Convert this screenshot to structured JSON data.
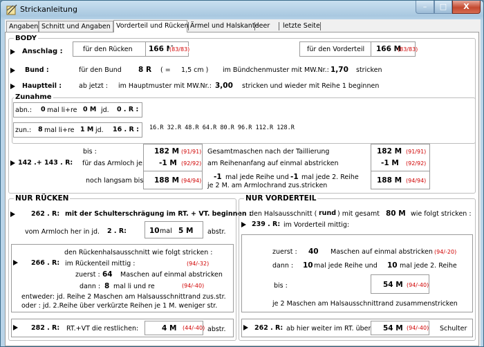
{
  "window": {
    "title": "Strickanleitung",
    "min": "–",
    "max": "□",
    "close": "X"
  },
  "tabs": [
    "Angaben",
    "Schnitt und Angaben",
    "Vorderteil und Rücken",
    "Ärmel und Halskante",
    "leer",
    "letzte Seite"
  ],
  "body": {
    "title": "BODY",
    "anschlag": {
      "label": "Anschlag :",
      "ruecken_label": "für den Rücken",
      "ruecken_val": "166 M",
      "ruecken_red": "(83/83)",
      "vorder_label": "für den Vorderteil",
      "vorder_val": "166 M",
      "vorder_red": "(83/83)"
    },
    "bund": {
      "label": "Bund :",
      "text1": "für den Bund",
      "r": "8  R",
      "eq": "(  =",
      "cm": "1,5  cm )",
      "text2": "im Bündchenmuster mit MW.Nr.:",
      "mw": "1,70",
      "text3": "stricken"
    },
    "hauptteil": {
      "label": "Hauptteil :",
      "text1": "ab jetzt :",
      "text2": "im Hauptmuster mit MW.Nr.:",
      "mw": "3,00",
      "text3": "stricken  und wieder mit Reihe 1 beginnen"
    },
    "zunahme": {
      "title": "Zunahme",
      "abn": {
        "label": "abn.:",
        "n": "0",
        "mal": "mal li+re",
        "m": "0 M",
        "jd": "jd.",
        "r": "0 . R :"
      },
      "zun": {
        "label": "zun.:",
        "n": "8",
        "mal": "mal li+re",
        "m": "1 M",
        "jd": "jd.",
        "r": "16 . R :",
        "rows": "16.R   32.R   48.R   64.R   80.R   96.R 112.R 128.R"
      }
    },
    "arm": {
      "range": "142 .+   143 . R:",
      "bis": "bis :",
      "fuer": "für das Armloch  je:",
      "langsam": "noch langsam bis :",
      "v1": "182 M",
      "r1": "(91/91)",
      "v2": "-1 M",
      "r2": "(92/92)",
      "v3": "188 M",
      "r3": "(94/94)",
      "g1": "Gesamtmaschen nach der Taillierung",
      "g2": "am Reihenanfang auf einmal abstricken",
      "g3a": "-1",
      "g3b": "mal jede Reihe und",
      "g3c": "-1",
      "g3d": "mal jede 2. Reihe",
      "g3e": "je 2 M. am Armlochrand zus.stricken",
      "w1": "182 M",
      "s1": "(91/91)",
      "w2": "-1 M",
      "s2": "(92/92)",
      "w3": "188 M",
      "s3": "(94/94)"
    }
  },
  "ruecken": {
    "title": "NUR RÜCKEN",
    "schulter": {
      "r": "262 . R:",
      "text": "mit der Schulterschrägung im RT. + VT. beginnen :",
      "text2": "vom Armloch her in jd.",
      "r2": "2 . R:",
      "mal": "10",
      "malt": "mal",
      "m": "5 M",
      "abstr": "abstr."
    },
    "hals": {
      "text1": "den Rückenhalsausschnitt wie folgt stricken :",
      "r": "266 . R:",
      "text2": "im Rückenteil mittig :",
      "red1": "(94/-32)",
      "zuerst": "zuerst :",
      "zn": "64",
      "zt": "Maschen    auf einmal abstricken",
      "dann": "dann :",
      "dn": "8",
      "dt": "mal  li  und  re",
      "red2": "(94/-40)",
      "ent1": "entweder: jd. Reihe 2 Maschen am Halsausschnittrand zus.str.",
      "ent2": "oder : jd. 2.Reihe über verkürzte Reihen je 1 M. weniger str."
    },
    "rest": {
      "r": "282 . R:",
      "text": "RT.+VT die restlichen:",
      "m": "4 M",
      "red": "(44/-40)",
      "abstr": "abstr."
    }
  },
  "vorder": {
    "title": "NUR VORDERTEIL",
    "text1": "den Halsausschnitt (",
    "rund": "rund",
    "text2": ")  mit gesamt",
    "m": "80 M",
    "text3": "wie folgt stricken :",
    "r": "239 . R:",
    "text4": "im Vorderteil mittig:",
    "zuerst": "zuerst :",
    "zn": "40",
    "zt": "Maschen auf einmal abstricken",
    "red1": "(94/-20)",
    "dann": "dann :",
    "d1": "10",
    "dt1": "mal jede Reihe und",
    "d2": "10",
    "dt2": "mal jede 2. Reihe",
    "bis": "bis :",
    "bm": "54 M",
    "bred": "(94/-40)",
    "je": "je 2 Maschen am Halsausschnittrand zusammenstricken",
    "weiter": {
      "r": "262 . R:",
      "text": "ab hier weiter im RT. über",
      "m": "54 M",
      "red": "(94/-40)",
      "sch": "Schulter"
    }
  }
}
